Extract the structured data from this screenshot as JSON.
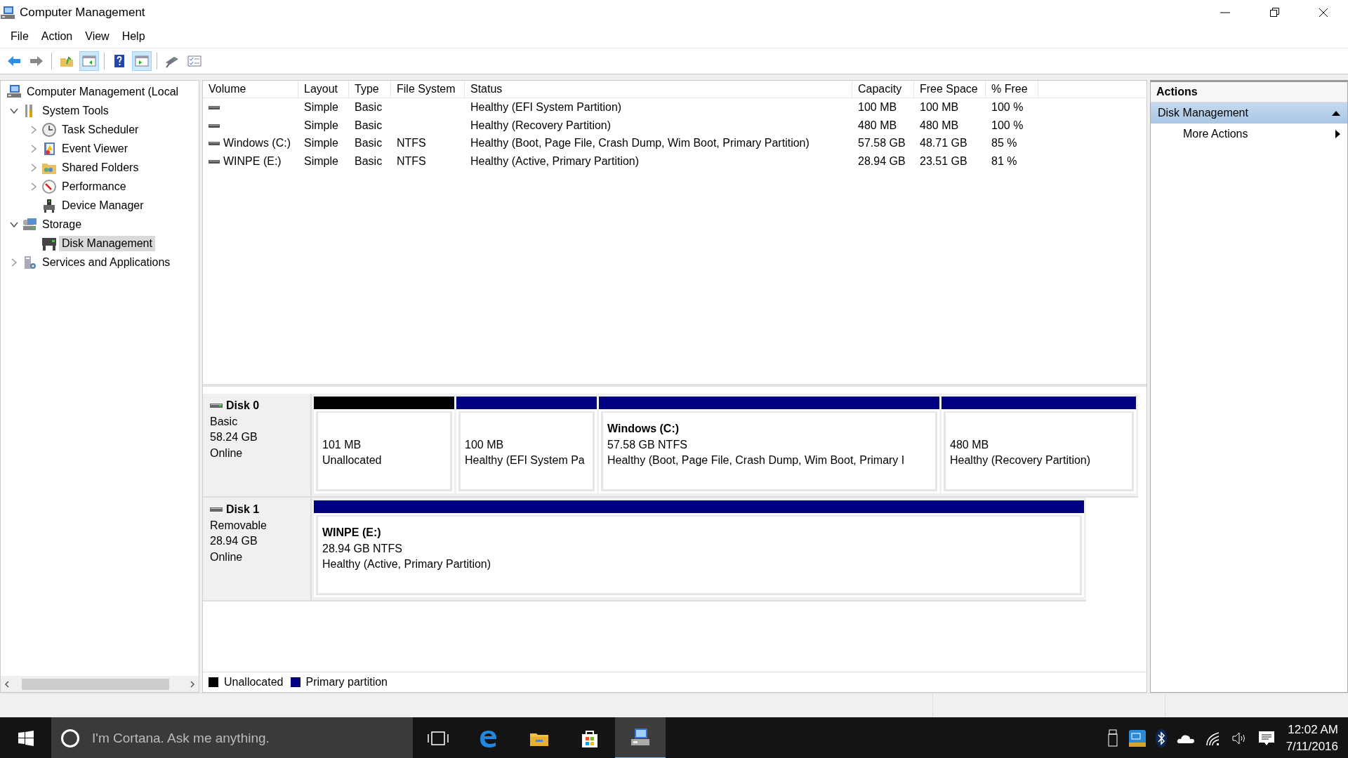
{
  "window": {
    "title": "Computer Management"
  },
  "menu": [
    {
      "label": "File"
    },
    {
      "label": "Action"
    },
    {
      "label": "View"
    },
    {
      "label": "Help"
    }
  ],
  "toolbar": [
    {
      "pressed": false
    },
    {
      "pressed": false
    },
    {
      "pressed": false
    },
    {
      "pressed": true
    },
    {
      "pressed": false
    },
    {
      "pressed": true
    },
    {
      "pressed": false
    },
    {
      "pressed": false
    }
  ],
  "tree": [
    {
      "label": "Computer Management (Local",
      "selected": false,
      "children": [
        {
          "label": "System Tools",
          "selected": false,
          "expanded": true,
          "children": [
            {
              "label": "Task Scheduler",
              "selected": false,
              "expanded": false
            },
            {
              "label": "Event Viewer",
              "selected": false,
              "expanded": false
            },
            {
              "label": "Shared Folders",
              "selected": false,
              "expanded": false
            },
            {
              "label": "Performance",
              "selected": false,
              "expanded": false
            },
            {
              "label": "Device Manager",
              "selected": false
            }
          ]
        },
        {
          "label": "Storage",
          "selected": false,
          "expanded": true,
          "children": [
            {
              "label": "Disk Management",
              "selected": true
            }
          ]
        },
        {
          "label": "Services and Applications",
          "selected": false,
          "expanded": false
        }
      ]
    }
  ],
  "table": {
    "columns": [
      "Volume",
      "Layout",
      "Type",
      "File System",
      "Status",
      "Capacity",
      "Free Space",
      "% Free"
    ],
    "rows": [
      {
        "cells": [
          "",
          "Simple",
          "Basic",
          "",
          "Healthy (EFI System Partition)",
          "100 MB",
          "100 MB",
          "100 %"
        ]
      },
      {
        "cells": [
          "",
          "Simple",
          "Basic",
          "",
          "Healthy (Recovery Partition)",
          "480 MB",
          "480 MB",
          "100 %"
        ]
      },
      {
        "cells": [
          "Windows (C:)",
          "Simple",
          "Basic",
          "NTFS",
          "Healthy (Boot, Page File, Crash Dump, Wim Boot, Primary Partition)",
          "57.58 GB",
          "48.71 GB",
          "85 %"
        ]
      },
      {
        "cells": [
          "WINPE (E:)",
          "Simple",
          "Basic",
          "NTFS",
          "Healthy (Active, Primary Partition)",
          "28.94 GB",
          "23.51 GB",
          "81 %"
        ]
      }
    ]
  },
  "disks": [
    {
      "name": "Disk 0",
      "type": "Basic",
      "size": "58.24 GB",
      "status": "Online",
      "partitions": [
        {
          "kind": "unallocated",
          "size": "101 MB",
          "status": "Unallocated"
        },
        {
          "kind": "primary",
          "size": "100 MB",
          "status": "Healthy (EFI System Pa"
        },
        {
          "kind": "primary",
          "label": "Windows (C:)",
          "size": "57.58 GB NTFS",
          "status": "Healthy (Boot, Page File, Crash Dump, Wim Boot, Primary I"
        },
        {
          "kind": "primary",
          "size": "480 MB",
          "status": "Healthy (Recovery Partition)"
        }
      ]
    },
    {
      "name": "Disk 1",
      "type": "Removable",
      "size": "28.94 GB",
      "status": "Online",
      "partitions": [
        {
          "kind": "primary",
          "label": "WINPE (E:)",
          "size": "28.94 GB NTFS",
          "status": "Healthy (Active, Primary Partition)"
        }
      ]
    }
  ],
  "legend": [
    {
      "label": "Unallocated",
      "color": "#000000"
    },
    {
      "label": "Primary partition",
      "color": "#000080"
    }
  ],
  "actions": {
    "title": "Actions",
    "sections": [
      {
        "label": "Disk Management",
        "expanded": true,
        "items": [
          {
            "label": "More Actions"
          }
        ]
      }
    ]
  },
  "taskbar": {
    "search": {
      "placeholder": "I'm Cortana. Ask me anything."
    },
    "apps": [
      {
        "active": false
      },
      {
        "active": false
      },
      {
        "active": false
      },
      {
        "active": true
      }
    ],
    "time": "12:02 AM",
    "date": "7/11/2016"
  }
}
